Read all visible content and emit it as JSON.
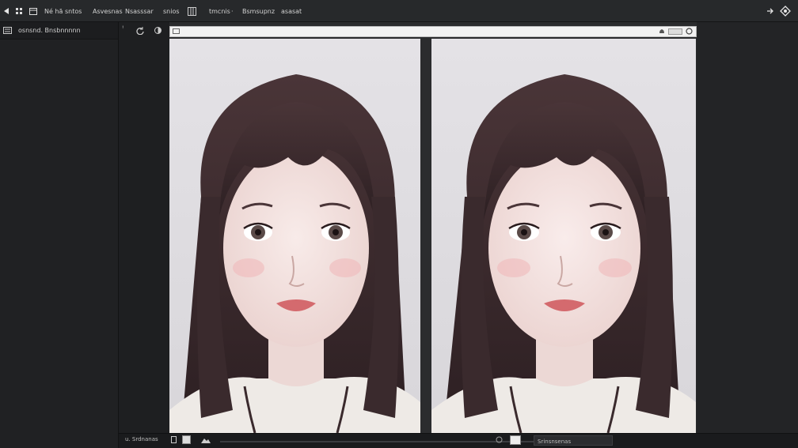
{
  "menubar": {
    "items": [
      "Né hă sntos",
      "Asvesnas",
      "Nsasssar",
      "snios",
      "tmcnis",
      "Bsmsupnz",
      "asasat"
    ]
  },
  "left_panel": {
    "header_label": "osnsnd. Bnsbnnnnn"
  },
  "statusbar": {
    "left_label": "u. Srdnanas",
    "right_label": "Srinsnsenas"
  },
  "progress": {
    "slider_position": 0.96
  },
  "photos": {
    "hair_color": "#3b2a2c",
    "skin_color": "#f3e3e1",
    "lip_color": "#d46a6e",
    "sweater_color": "#eeeae6"
  },
  "colors": {
    "menubar_bg": "#27292b",
    "panel_bg": "#202123",
    "canvas_bg": "#2a2b2d"
  }
}
